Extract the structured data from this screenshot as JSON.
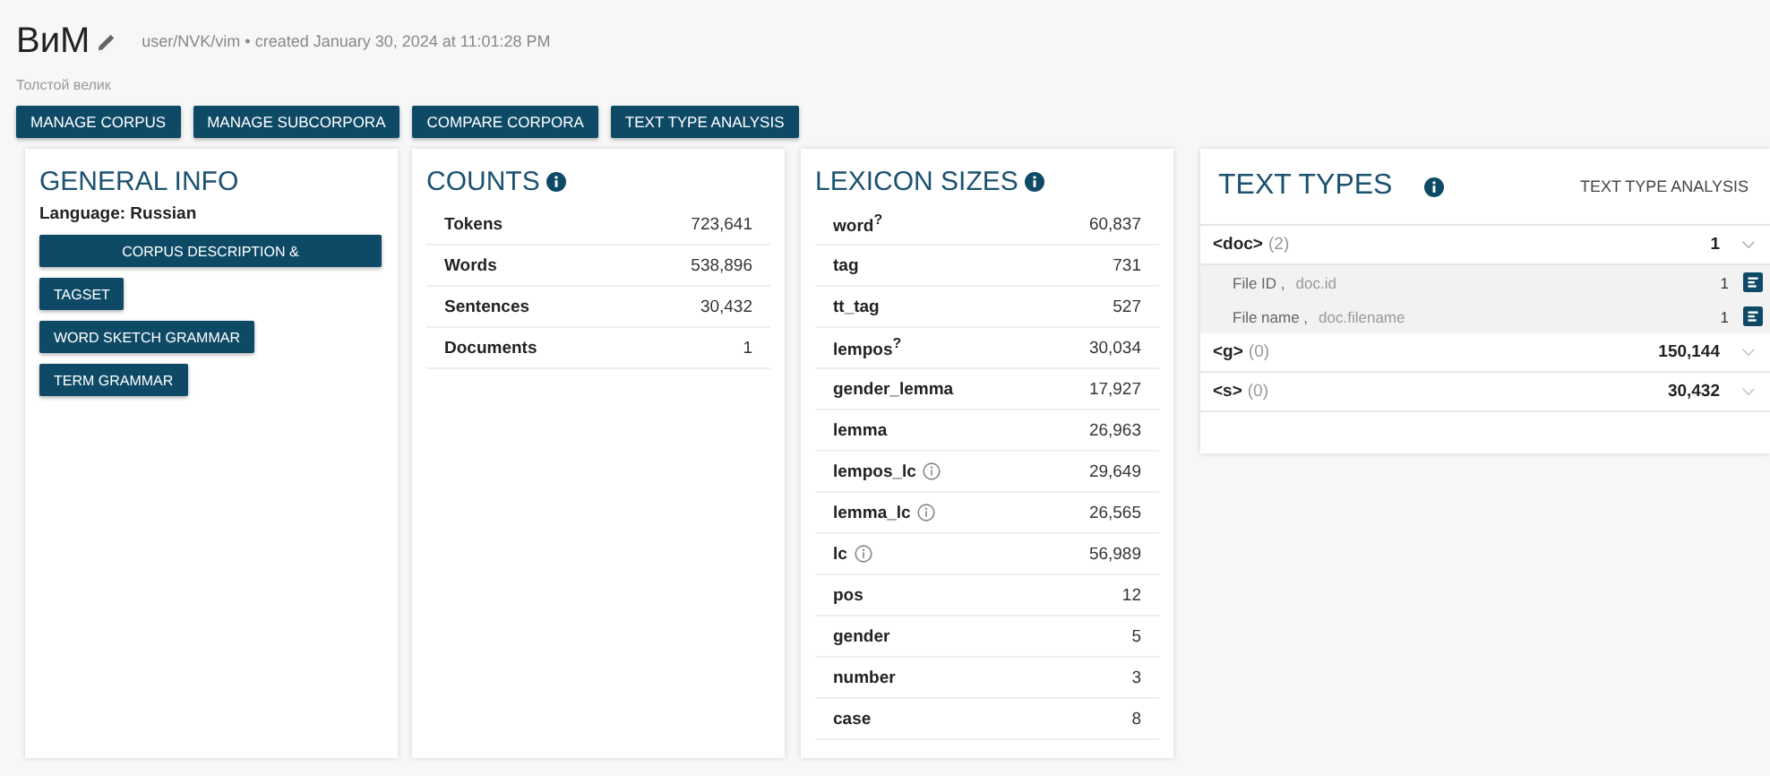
{
  "header": {
    "title": "ВиМ",
    "meta": "user/NVK/vim • created January 30, 2024 at 11:01:28 PM",
    "subtitle": "Толстой велик"
  },
  "actions": [
    "MANAGE CORPUS",
    "MANAGE SUBCORPORA",
    "COMPARE CORPORA",
    "TEXT TYPE ANALYSIS"
  ],
  "general_info": {
    "title": "GENERAL INFO",
    "language": "Language: Russian",
    "buttons": [
      {
        "label": "CORPUS DESCRIPTION &",
        "wide": true
      },
      {
        "label": "TAGSET",
        "wide": false
      },
      {
        "label": "WORD SKETCH GRAMMAR",
        "wide": false
      },
      {
        "label": "TERM GRAMMAR",
        "wide": false
      }
    ]
  },
  "counts": {
    "title": "COUNTS",
    "rows": [
      {
        "label": "Tokens",
        "value": "723,641"
      },
      {
        "label": "Words",
        "value": "538,896"
      },
      {
        "label": "Sentences",
        "value": "30,432"
      },
      {
        "label": "Documents",
        "value": "1"
      }
    ]
  },
  "lexicon_sizes": {
    "title": "LEXICON SIZES",
    "rows": [
      {
        "label": "word$^{?}$",
        "value": "60,837",
        "hint": false
      },
      {
        "label": "tag",
        "value": "731",
        "hint": false
      },
      {
        "label": "tt_tag",
        "value": "527",
        "hint": false
      },
      {
        "label": "lempos$^{?}$",
        "value": "30,034",
        "hint": false
      },
      {
        "label": "gender_lemma",
        "value": "17,927",
        "hint": false
      },
      {
        "label": "lemma",
        "value": "26,963",
        "hint": false
      },
      {
        "label": "lempos_lc",
        "value": "29,649",
        "hint": true
      },
      {
        "label": "lemma_lc",
        "value": "26,565",
        "hint": true
      },
      {
        "label": "lc",
        "value": "56,989",
        "hint": true
      },
      {
        "label": "pos",
        "value": "12",
        "hint": false
      },
      {
        "label": "gender",
        "value": "5",
        "hint": false
      },
      {
        "label": "number",
        "value": "3",
        "hint": false
      },
      {
        "label": "case",
        "value": "8",
        "hint": false
      }
    ]
  },
  "text_types": {
    "title": "TEXT TYPES",
    "link": "TEXT TYPE ANALYSIS",
    "groups": [
      {
        "name": "<doc>",
        "count": "(2)",
        "value": "1",
        "expanded": true,
        "children": [
          {
            "label": "File ID ,",
            "attr": "doc.id",
            "value": "1"
          },
          {
            "label": "File name ,",
            "attr": "doc.filename",
            "value": "1"
          }
        ]
      },
      {
        "name": "<g>",
        "count": "(0)",
        "value": "150,144",
        "expanded": false
      },
      {
        "name": "<s>",
        "count": "(0)",
        "value": "30,432",
        "expanded": false
      }
    ]
  }
}
